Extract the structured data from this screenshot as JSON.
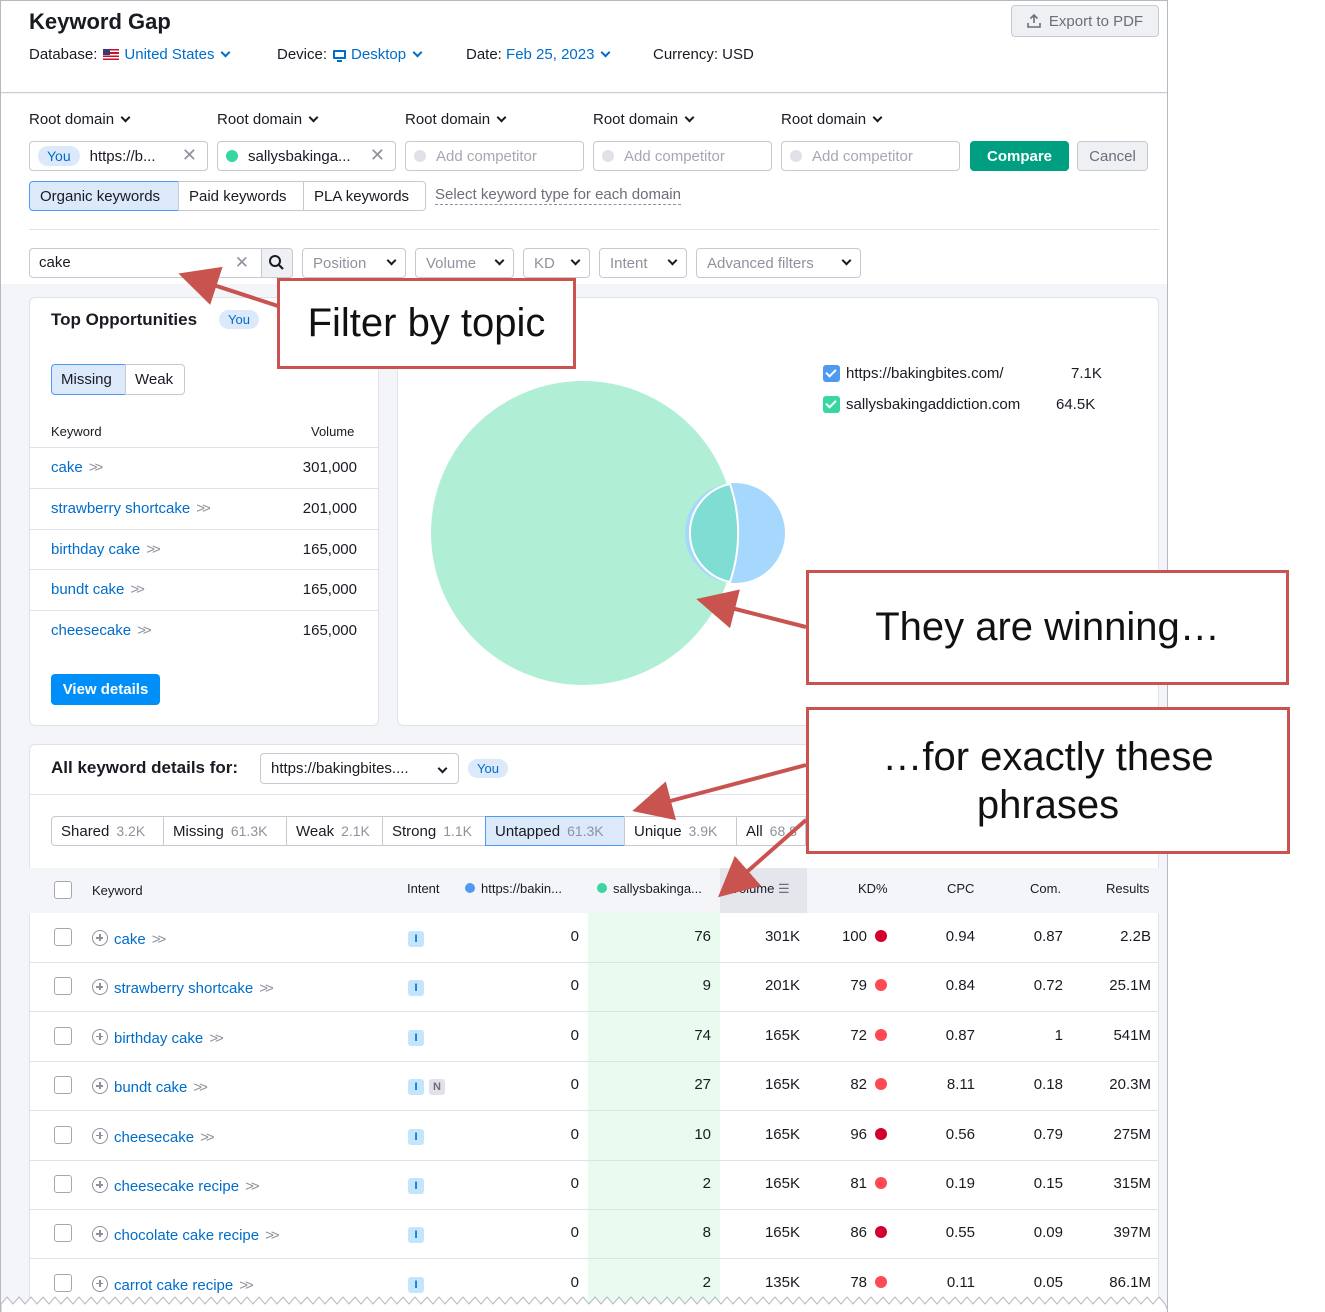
{
  "header": {
    "title": "Keyword Gap",
    "export_label": "Export to PDF",
    "database_label": "Database:",
    "database_value": "United States",
    "device_label": "Device:",
    "device_value": "Desktop",
    "date_label": "Date:",
    "date_value": "Feb 25, 2023",
    "currency": "Currency: USD"
  },
  "domains": {
    "root_label": "Root domain",
    "you_badge": "You",
    "you_domain": "https://b...",
    "competitor1": "sallysbakinga...",
    "add_placeholder": "Add competitor",
    "compare_label": "Compare",
    "cancel_label": "Cancel"
  },
  "keyword_types": {
    "organic": "Organic keywords",
    "paid": "Paid keywords",
    "pla": "PLA keywords",
    "select_hint": "Select keyword type for each domain"
  },
  "filters": {
    "search_value": "cake",
    "position": "Position",
    "volume": "Volume",
    "kd": "KD",
    "intent": "Intent",
    "advanced": "Advanced filters"
  },
  "top_opportunities": {
    "title": "Top Opportunities",
    "badge": "You",
    "missing": "Missing",
    "weak": "Weak",
    "col_keyword": "Keyword",
    "col_volume": "Volume",
    "rows": [
      {
        "keyword": "cake",
        "volume": "301,000"
      },
      {
        "keyword": "strawberry shortcake",
        "volume": "201,000"
      },
      {
        "keyword": "birthday cake",
        "volume": "165,000"
      },
      {
        "keyword": "bundt cake",
        "volume": "165,000"
      },
      {
        "keyword": "cheesecake",
        "volume": "165,000"
      }
    ],
    "view_details": "View details"
  },
  "venn": {
    "legend": [
      {
        "domain": "https://bakingbites.com/",
        "value": "7.1K",
        "color": "#4e9af1"
      },
      {
        "domain": "sallysbakingaddiction.com",
        "value": "64.5K",
        "color": "#38d6a0"
      }
    ]
  },
  "details": {
    "label": "All keyword details for:",
    "domain_select": "https://bakingbites....",
    "badge": "You",
    "tabs": [
      {
        "label": "Shared",
        "count": "3.2K"
      },
      {
        "label": "Missing",
        "count": "61.3K"
      },
      {
        "label": "Weak",
        "count": "2.1K"
      },
      {
        "label": "Strong",
        "count": "1.1K"
      },
      {
        "label": "Untapped",
        "count": "61.3K"
      },
      {
        "label": "Unique",
        "count": "3.9K"
      },
      {
        "label": "All",
        "count": "68.8"
      }
    ]
  },
  "table": {
    "headers": {
      "keyword": "Keyword",
      "intent": "Intent",
      "domain1": "https://bakin...",
      "domain2": "sallysbakinga...",
      "volume": "Volume",
      "kd": "KD%",
      "cpc": "CPC",
      "com": "Com.",
      "results": "Results"
    },
    "rows": [
      {
        "keyword": "cake",
        "intent": [
          "I"
        ],
        "d1": "0",
        "d2": "76",
        "volume": "301K",
        "kd": "100",
        "cpc": "0.94",
        "com": "0.87",
        "results": "2.2B"
      },
      {
        "keyword": "strawberry shortcake",
        "intent": [
          "I"
        ],
        "d1": "0",
        "d2": "9",
        "volume": "201K",
        "kd": "79",
        "cpc": "0.84",
        "com": "0.72",
        "results": "25.1M"
      },
      {
        "keyword": "birthday cake",
        "intent": [
          "I"
        ],
        "d1": "0",
        "d2": "74",
        "volume": "165K",
        "kd": "72",
        "cpc": "0.87",
        "com": "1",
        "results": "541M"
      },
      {
        "keyword": "bundt cake",
        "intent": [
          "I",
          "N"
        ],
        "d1": "0",
        "d2": "27",
        "volume": "165K",
        "kd": "82",
        "cpc": "8.11",
        "com": "0.18",
        "results": "20.3M"
      },
      {
        "keyword": "cheesecake",
        "intent": [
          "I"
        ],
        "d1": "0",
        "d2": "10",
        "volume": "165K",
        "kd": "96",
        "cpc": "0.56",
        "com": "0.79",
        "results": "275M"
      },
      {
        "keyword": "cheesecake recipe",
        "intent": [
          "I"
        ],
        "d1": "0",
        "d2": "2",
        "volume": "165K",
        "kd": "81",
        "cpc": "0.19",
        "com": "0.15",
        "results": "315M"
      },
      {
        "keyword": "chocolate cake recipe",
        "intent": [
          "I"
        ],
        "d1": "0",
        "d2": "8",
        "volume": "165K",
        "kd": "86",
        "cpc": "0.55",
        "com": "0.09",
        "results": "397M"
      },
      {
        "keyword": "carrot cake recipe",
        "intent": [
          "I"
        ],
        "d1": "0",
        "d2": "2",
        "volume": "135K",
        "kd": "78",
        "cpc": "0.11",
        "com": "0.05",
        "results": "86.1M"
      }
    ]
  },
  "callouts": {
    "filter": "Filter by topic",
    "winning": "They are winning…",
    "phrases": "…for exactly these phrases"
  },
  "colors": {
    "accent_blue": "#006dca",
    "compare_green": "#009f81",
    "kd_very_hard": "#d1002f",
    "kd_hard": "#ff4953",
    "callout_red": "#c9534f"
  }
}
